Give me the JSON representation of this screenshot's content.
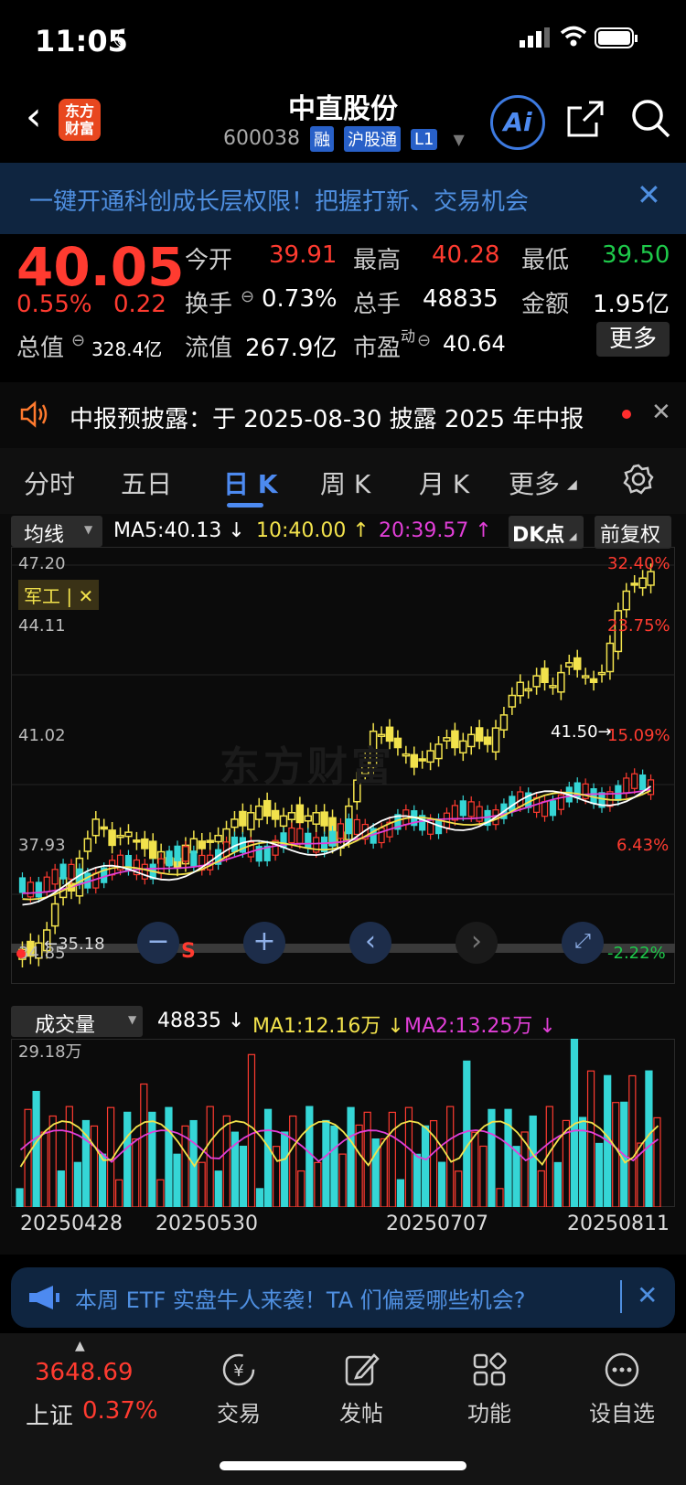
{
  "status": {
    "time": "11:05"
  },
  "nav": {
    "logo_line1": "东方",
    "logo_line2": "财富",
    "title": "中直股份",
    "code": "600038",
    "tags": [
      "融",
      "沪股通",
      "L1"
    ],
    "ai": "Ai"
  },
  "banner": {
    "text": "一键开通科创成长层权限！把握打新、交易机会"
  },
  "quote": {
    "price": "40.05",
    "pct": "0.55%",
    "chg": "0.22",
    "open_label": "今开",
    "open": "39.91",
    "high_label": "最高",
    "high": "40.28",
    "low_label": "最低",
    "low": "39.50",
    "turnover_label": "换手",
    "turnover": "0.73%",
    "volume_label": "总手",
    "volume": "48835",
    "amount_label": "金额",
    "amount": "1.95亿",
    "mcap_label": "总值",
    "mcap": "328.4亿",
    "float_label": "流值",
    "float": "267.9亿",
    "pe_label": "市盈",
    "pe_sup": "动",
    "pe": "40.64",
    "more": "更多"
  },
  "disclose": {
    "text": "中报预披露：于 2025-08-30 披露 2025 年中报"
  },
  "tabs": [
    "分时",
    "五日",
    "日 K",
    "周 K",
    "月 K",
    "更多"
  ],
  "active_tab": "日 K",
  "ma": {
    "selector": "均线",
    "ma5": "MA5:40.13",
    "ma10": "10:40.00",
    "ma20": "20:39.57",
    "dk": "DK点",
    "adjust": "前复权"
  },
  "chart": {
    "ylabels": [
      "47.20",
      "44.11",
      "41.02",
      "37.93",
      "34.85"
    ],
    "pctlabels": [
      "32.40%",
      "23.75%",
      "15.09%",
      "6.43%",
      "-2.22%"
    ],
    "sector_tag": "军工 | ✕",
    "high_mark": "41.50",
    "low_mark": "35.18",
    "watermark": "东方财富",
    "sell_mark": "S"
  },
  "vol": {
    "selector": "成交量",
    "value": "48835",
    "ma1": "MA1:12.16万",
    "ma2": "MA2:13.25万",
    "max": "29.18万"
  },
  "dates": [
    "20250428",
    "20250530",
    "20250707",
    "20250811"
  ],
  "etf": {
    "text": "本周 ETF 实盘牛人来袭！TA 们偏爱哪些机会?"
  },
  "bottom": {
    "index_value": "3648.69",
    "index_name": "上证",
    "index_pct": "0.37%",
    "items": [
      "交易",
      "发帖",
      "功能",
      "设自选"
    ]
  },
  "colors": {
    "up": "#ff3b30",
    "down": "#1ec94a",
    "ma5": "#ffffff",
    "ma10": "#f2e24c",
    "ma20": "#e23fd8",
    "bar_up": "#ff3b30",
    "bar_down": "#35d6d6"
  }
}
